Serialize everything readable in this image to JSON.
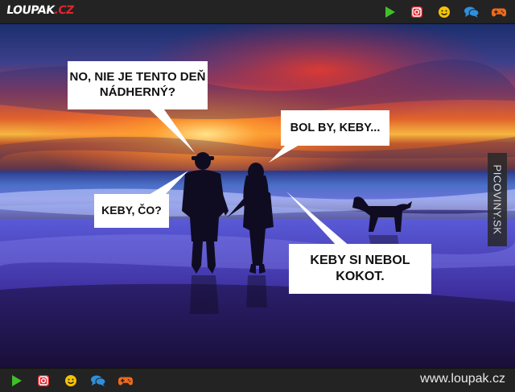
{
  "header": {
    "logo_text": "LOUPAK",
    "logo_dot": ".",
    "logo_tld": "CZ",
    "icons": [
      "play-icon",
      "instagram-icon",
      "smiley-icon",
      "chat-icon",
      "gamepad-icon"
    ]
  },
  "meme": {
    "bubble_1": "NO, NIE JE TENTO DEŇ NÁDHERNÝ?",
    "bubble_2": "BOL BY, KEBY...",
    "bubble_3": "KEBY, ČO?",
    "bubble_4": "KEBY SI NEBOL KOKOT.",
    "watermark": "PICOVINY.SK"
  },
  "footer": {
    "site_url": "www.loupak.cz",
    "icons": [
      "play-icon",
      "instagram-icon",
      "smiley-icon",
      "chat-icon",
      "gamepad-icon"
    ]
  },
  "colors": {
    "bar_bg": "#232323",
    "play_green": "#3fbf2a",
    "instagram_red": "#e0262d",
    "smiley_yellow": "#f5c400",
    "chat_blue": "#2f8fdc",
    "gamepad_orange": "#f06a1a"
  }
}
